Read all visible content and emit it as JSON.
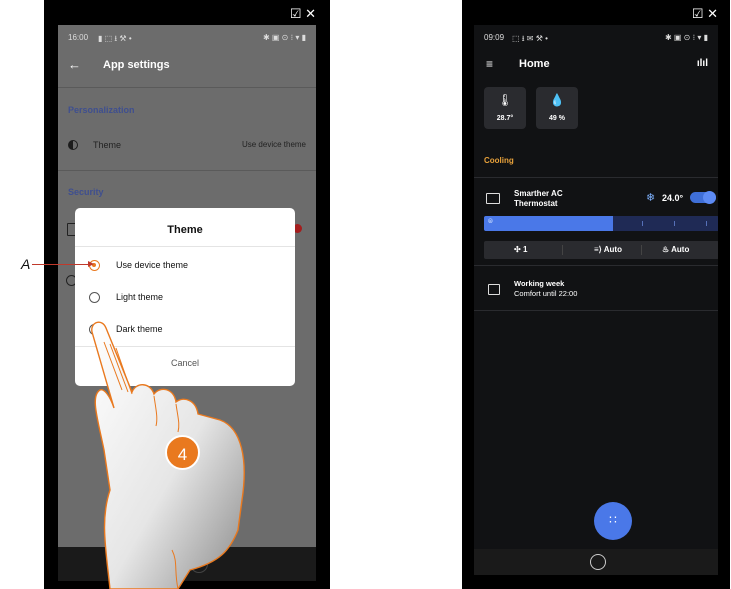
{
  "left_phone": {
    "window_controls": "☑ ✕",
    "status_time": "16:00",
    "status_left_icons": "▮ ⬚ ⭳ ⚒ •",
    "status_right_icons": "✱ ▣ ⊙ ⁝ ▾ ▮",
    "app_bar": {
      "back": "←",
      "title": "App settings"
    },
    "section_personalization": "Personalization",
    "theme_row": {
      "label": "Theme",
      "value": "Use device theme"
    },
    "section_security": "Security",
    "dialog": {
      "title": "Theme",
      "options": [
        {
          "label": "Use device theme",
          "selected": true
        },
        {
          "label": "Light theme",
          "selected": false
        },
        {
          "label": "Dark theme",
          "selected": false
        }
      ],
      "cancel": "Cancel"
    }
  },
  "callout": {
    "letter": "A",
    "step": "4"
  },
  "right_phone": {
    "window_controls": "☑ ✕",
    "status_time": "09:09",
    "status_left_icons": "⬚ ⭳ ✉ ⚒ •",
    "status_right_icons": "✱ ▣ ⊙ ⁝ ▾ ▮",
    "app_bar": {
      "menu": "≡",
      "title": "Home",
      "chart": "ılıl"
    },
    "tiles": [
      {
        "icon": "🌡",
        "value": "28.7°"
      },
      {
        "icon": "💧",
        "value": "49 %"
      }
    ],
    "section": "Cooling",
    "device": {
      "name_line1": "Smarther AC",
      "name_line2": "Thermostat",
      "temperature": "24.0°",
      "on": true,
      "slider_level": 0.55,
      "slider_zero": "⦾"
    },
    "controls": [
      {
        "icon": "✣",
        "label": "1"
      },
      {
        "icon": "≡⟩",
        "label": "Auto"
      },
      {
        "icon": "♨",
        "label": "Auto"
      }
    ],
    "schedule": {
      "title": "Working week",
      "subtitle": "Comfort until 22:00"
    },
    "fab_icon": "∷"
  },
  "colors": {
    "accent": "#e9791f",
    "primary": "#4a78e8",
    "cooling": "#e9a23b"
  }
}
